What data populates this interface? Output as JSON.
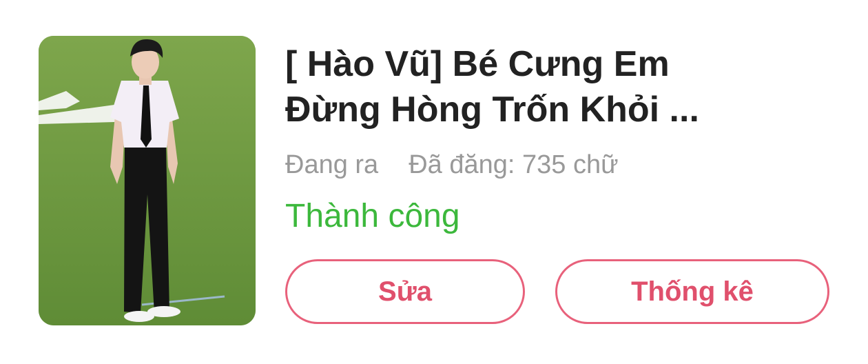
{
  "story": {
    "cover_alt": "cover-image",
    "title_line1": "[ Hào Vũ] Bé Cưng Em",
    "title_line2": "Đừng Hòng Trốn Khỏi ...",
    "progress_status": "Đang ra",
    "published_label": "Đã đăng: 735 chữ",
    "result_status": "Thành công",
    "colors": {
      "success": "#3cb83c",
      "accent": "#e8617b",
      "muted": "#999999"
    }
  },
  "actions": {
    "edit_label": "Sửa",
    "stats_label": "Thống kê"
  }
}
